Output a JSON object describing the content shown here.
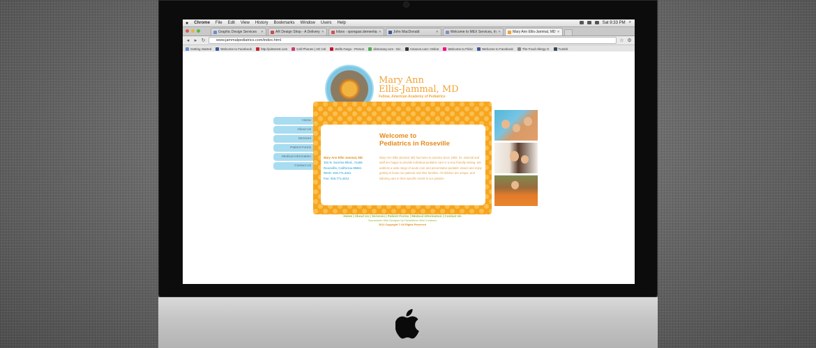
{
  "menubar": {
    "app": "Chrome",
    "items": [
      "File",
      "Edit",
      "View",
      "History",
      "Bookmarks",
      "Window",
      "Users",
      "Help"
    ],
    "clock": "Sat 9:33 PM"
  },
  "tabs": [
    {
      "label": "Graphic Design Services",
      "color": "#6a8fd0"
    },
    {
      "label": "AR Design Shop - A Delivery",
      "color": "#c94b4b"
    },
    {
      "label": "Inbox - spongasi.dementia",
      "color": "#d65050"
    },
    {
      "label": "John MacDonald",
      "color": "#3b5998"
    },
    {
      "label": "Welcome to MEX Services, In",
      "color": "#7b8fc0"
    },
    {
      "label": "Mary Ann Ellis-Jammal, MD",
      "color": "#f1a235"
    }
  ],
  "toolbar": {
    "url": "www.jammalpediatrics.com/index.html"
  },
  "bookmarks": [
    {
      "label": "Getting Started",
      "color": "#6a8fd0"
    },
    {
      "label": "Welcome to Facebook",
      "color": "#3b5998"
    },
    {
      "label": "http://pinterest.com",
      "color": "#c8232c"
    },
    {
      "label": "Cell Phones | 4G Cel",
      "color": "#d2367a"
    },
    {
      "label": "Wells Fargo - Person",
      "color": "#c8102e"
    },
    {
      "label": "dictionary.com - Dic",
      "color": "#4caf50"
    },
    {
      "label": "Amazon.com: Online",
      "color": "#333333"
    },
    {
      "label": "Welcome to Flickr",
      "color": "#ff0084"
    },
    {
      "label": "Welcome to Facebook",
      "color": "#3b5998"
    },
    {
      "label": "The Food Allergy G",
      "color": "#888888"
    },
    {
      "label": "Tumblr",
      "color": "#35465c"
    }
  ],
  "site": {
    "title_line1": "Mary Ann",
    "title_line2": "Ellis-Jammal, MD",
    "subtitle": "Fellow, American Academy of Pediatrics",
    "nav": [
      "Home",
      "About Us",
      "Services",
      "Patient Forms",
      "Medical Information",
      "Contact Us"
    ],
    "contact": {
      "name": "Mary Ann Ellis-Jammal, MD",
      "address1": "151 N. Sunrise Blvd., #1405",
      "address2": "Roseville, California  95661",
      "work": "Work: 916.771.4411",
      "fax": "Fax: 916.771.4413"
    },
    "welcome_line1": "Welcome to",
    "welcome_line2": "Pediatrics in Roseville",
    "intro": "Mary Ann Ellis-Jammal, MD has been in practice since 1993. Dr. Jammal and staff are happy to provide individual pediatric care in a very friendly setting. We address a wide range of acute care and preventative pediatric issues and enjoy getting to know our patients and their families. All children are unique, and tailoring care to their specific needs is our passion.",
    "footer_links": "Home  |  About Us  |  Services  |  Patient Forms  |  Medical Information  |  Contact Us",
    "footer_credit": "Sacramento Web Designer by FaziaWeber Web Creations",
    "footer_copy": "2011 Copyright © All Rights Reserved"
  },
  "colors": {
    "accent_orange": "#f6a51e",
    "nav_blue": "#a8dcf0",
    "link_green": "#8fba3a",
    "info_blue": "#58b6e0"
  }
}
